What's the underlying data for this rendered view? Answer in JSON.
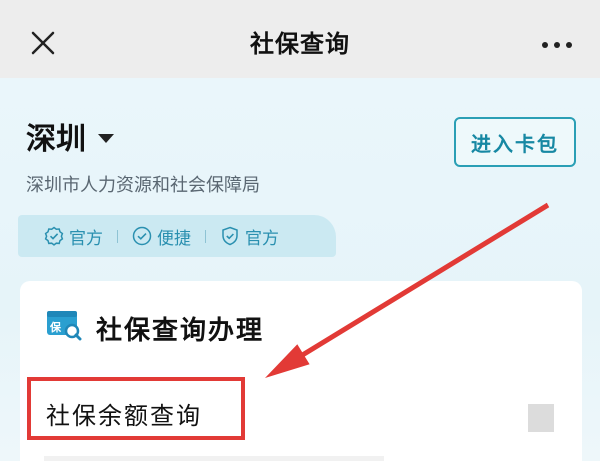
{
  "header": {
    "title": "社保查询"
  },
  "hero": {
    "city": "深圳",
    "subtitle": "深圳市人力资源和社会保障局",
    "card_button": "进入卡包",
    "tags": [
      "官方",
      "便捷",
      "官方"
    ]
  },
  "panel": {
    "title": "社保查询办理",
    "icon_text": "保",
    "items": [
      "社保余额查询"
    ]
  },
  "colors": {
    "accent": "#2a9fb5",
    "annotation": "#e23a36"
  }
}
